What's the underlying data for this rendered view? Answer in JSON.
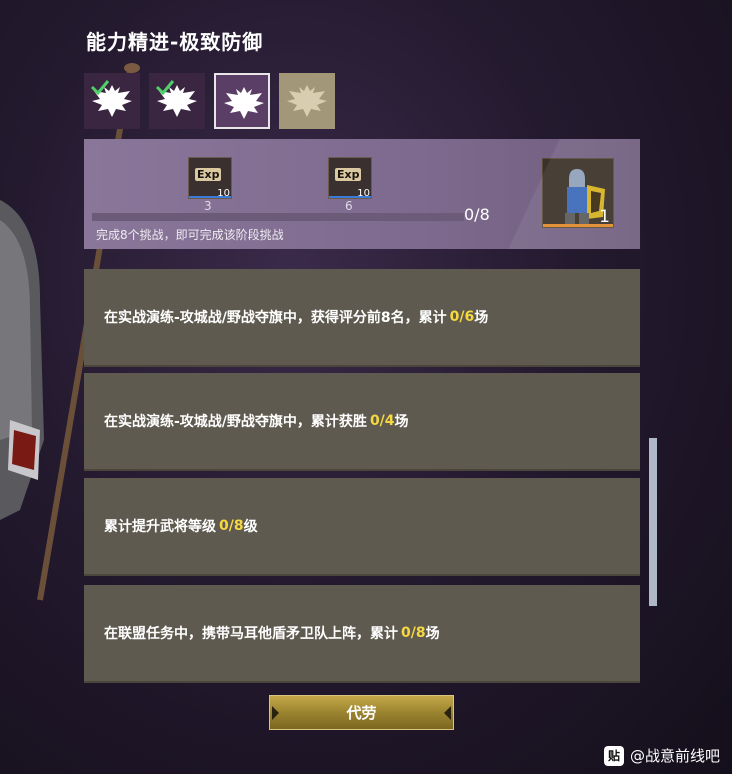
{
  "page": {
    "title": "能力精进-极致防御"
  },
  "tiers": [
    {
      "state": "completed",
      "icon": "eagle-emblem-icon"
    },
    {
      "state": "completed",
      "icon": "eagle-emblem-icon"
    },
    {
      "state": "active",
      "icon": "eagle-emblem-icon"
    },
    {
      "state": "locked",
      "icon": "eagle-emblem-icon"
    }
  ],
  "stage": {
    "milestones": [
      {
        "label": "Exp",
        "quantity": "10",
        "threshold": "3"
      },
      {
        "label": "Exp",
        "quantity": "10",
        "threshold": "6"
      }
    ],
    "progress": {
      "current": 0,
      "total": 8,
      "text": "0/8"
    },
    "hint": "完成8个挑战，即可完成该阶段挑战",
    "reward": {
      "quantity": "1",
      "icon": "knight-unit-icon"
    }
  },
  "tasks": [
    {
      "text": "在实战演练-攻城战/野战夺旗中，获得评分前8名，累计",
      "progress": "0/6",
      "suffix": "场"
    },
    {
      "text": "在实战演练-攻城战/野战夺旗中，累计获胜",
      "progress": "0/4",
      "suffix": "场"
    },
    {
      "text": "累计提升武将等级",
      "progress": "0/8",
      "suffix": "级"
    },
    {
      "text": "在联盟任务中，携带马耳他盾矛卫队上阵，累计",
      "progress": "0/8",
      "suffix": "场"
    }
  ],
  "actions": {
    "proxy_label": "代劳"
  },
  "watermark": {
    "logo_text": "贴",
    "text": "@战意前线吧"
  },
  "colors": {
    "progress_highlight": "#f5d842",
    "panel": "#5e5a4f",
    "stage_panel": "#8a7699",
    "button_gold": "#9b8430"
  }
}
